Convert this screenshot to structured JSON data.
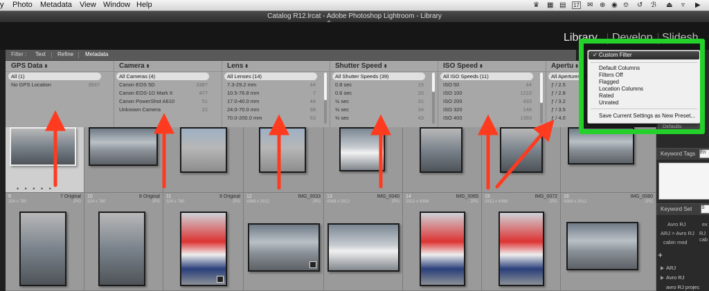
{
  "menubar": {
    "items": [
      "y",
      "Photo",
      "Metadata",
      "View",
      "Window",
      "Help"
    ],
    "tray": {
      "date": "17"
    }
  },
  "window": {
    "title": "Catalog R12.lrcat - Adobe Photoshop Lightroom - Library"
  },
  "modules": {
    "library": "Library",
    "develop": "Develop",
    "slideshow": "Slidesh"
  },
  "filter_bar": {
    "label": "Filter :",
    "tabs": [
      "Text",
      "Refine",
      "Metadata"
    ]
  },
  "columns": [
    {
      "header": "GPS Data",
      "rows": [
        {
          "label": "All (1)",
          "count": ""
        },
        {
          "label": "No GPS Location",
          "count": "3937"
        }
      ]
    },
    {
      "header": "Camera",
      "rows": [
        {
          "label": "All Cameras (4)",
          "count": ""
        },
        {
          "label": "Canon EOS 5D",
          "count": "3387"
        },
        {
          "label": "Canon EOS-1D Mark II",
          "count": "477"
        },
        {
          "label": "Canon PowerShot A610",
          "count": "51"
        },
        {
          "label": "Unknown Camera",
          "count": "22"
        }
      ]
    },
    {
      "header": "Lens",
      "rows": [
        {
          "label": "All Lenses (14)",
          "count": ""
        },
        {
          "label": "7.3-29.2 mm",
          "count": "44"
        },
        {
          "label": "10.5-76.8 mm",
          "count": "7"
        },
        {
          "label": "17.0-40.0 mm",
          "count": "44"
        },
        {
          "label": "24.0-70.0 mm",
          "count": "98"
        },
        {
          "label": "70.0-200.0 mm",
          "count": "63"
        }
      ]
    },
    {
      "header": "Shutter Speed",
      "rows": [
        {
          "label": "All Shutter Speeds (39)",
          "count": ""
        },
        {
          "label": "0.8 sec",
          "count": "15"
        },
        {
          "label": "0.6 sec",
          "count": "20"
        },
        {
          "label": "½ sec",
          "count": "31"
        },
        {
          "label": "⅓ sec",
          "count": "34"
        },
        {
          "label": "⅓ sec",
          "count": "43"
        }
      ]
    },
    {
      "header": "ISO Speed",
      "rows": [
        {
          "label": "All ISO Speeds (11)",
          "count": ""
        },
        {
          "label": "ISO 50",
          "count": "44"
        },
        {
          "label": "ISO 100",
          "count": "1210"
        },
        {
          "label": "ISO 200",
          "count": "433"
        },
        {
          "label": "ISO 320",
          "count": "148"
        },
        {
          "label": "ISO 400",
          "count": "1393"
        }
      ]
    },
    {
      "header": "Apertu",
      "rows": [
        {
          "label": "All Apertures (1",
          "count": ""
        },
        {
          "label": "ƒ / 2.5",
          "count": ""
        },
        {
          "label": "ƒ / 2.8",
          "count": ""
        },
        {
          "label": "ƒ / 3.2",
          "count": ""
        },
        {
          "label": "ƒ / 3.5",
          "count": ""
        },
        {
          "label": "ƒ / 4.0",
          "count": ""
        }
      ]
    }
  ],
  "grid": {
    "row2": [
      {
        "index": "9",
        "name": "7 Original",
        "dims": "324 x 780",
        "ext": "JPG"
      },
      {
        "index": "10",
        "name": "8 Original",
        "dims": "324 x 780",
        "ext": "JPG"
      },
      {
        "index": "11",
        "name": "9 Original",
        "dims": "324 x 780",
        "ext": "JPG"
      },
      {
        "index": "12",
        "name": "IMG_0033",
        "dims": "4368 x 2912",
        "ext": "JPG"
      },
      {
        "index": "13",
        "name": "IMG_0040",
        "dims": "4368 x 2912",
        "ext": "JPG"
      },
      {
        "index": "14",
        "name": "IMG_0065",
        "dims": "2912 x 4368",
        "ext": "JPG"
      },
      {
        "index": "15",
        "name": "IMG_0072",
        "dims": "2912 x 4368",
        "ext": "JPG"
      },
      {
        "index": "16",
        "name": "IMG_0080",
        "dims": "4368 x 2912",
        "ext": "JPG"
      }
    ]
  },
  "preset_menu": {
    "selected": "✓ Custom Filter",
    "options": [
      "Default Columns",
      "Filters Off",
      "Flagged",
      "Location Columns",
      "Rated",
      "Unrated"
    ],
    "save": "Save Current Settings as New Preset..."
  },
  "right_panel": {
    "defaults": "Defaults",
    "keyword_tags": "Keyword Tags",
    "keyword_tags_field": "En",
    "keyword_set": "Keyword Set",
    "keyword_set_field": "S",
    "chips": [
      "Avro RJ",
      "ex",
      "ARJ > Avro RJ",
      "RJ cab",
      "cabin mod"
    ],
    "tree": [
      "ARJ",
      "Avro RJ",
      "avro RJ projec"
    ],
    "plus": "+"
  },
  "colors": {
    "highlight_box": "#24d12a",
    "annotation_arrow": "#ff3b1f",
    "grid_bg": "#8f8f8f"
  }
}
